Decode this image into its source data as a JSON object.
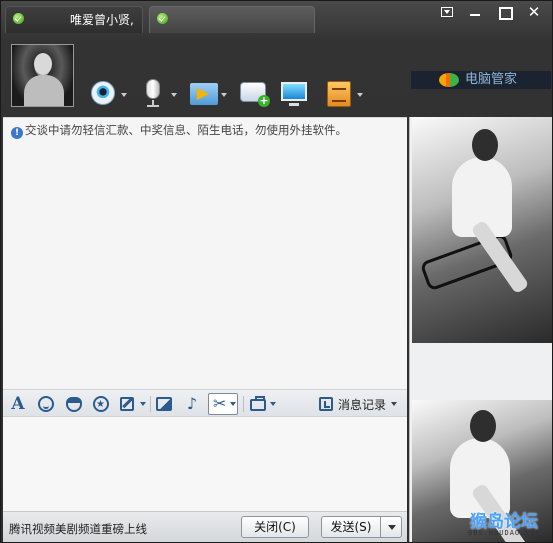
{
  "window": {
    "tab_active_name": "唯爱曾小贤,",
    "tab_second_name": ""
  },
  "brand": {
    "text": "电脑管家"
  },
  "chat": {
    "notice": "交谈中请勿轻信汇款、中奖信息、陌生电话，勿使用外挂软件。"
  },
  "format_toolbar": {
    "history_label": "消息记录"
  },
  "bottom": {
    "promo": "腾讯视频美剧频道重磅上线",
    "close_label": "关闭(C)",
    "send_label": "发送(S)"
  },
  "watermark": {
    "text": "猴岛论坛",
    "sub": "BBS.HOUDAO.COM"
  },
  "icons": {
    "title_check": "check-icon",
    "camera": "webcam-icon",
    "mic": "microphone-icon",
    "file": "file-transfer-icon",
    "message": "new-message-icon",
    "screen": "remote-desktop-icon",
    "app": "app-box-icon"
  }
}
